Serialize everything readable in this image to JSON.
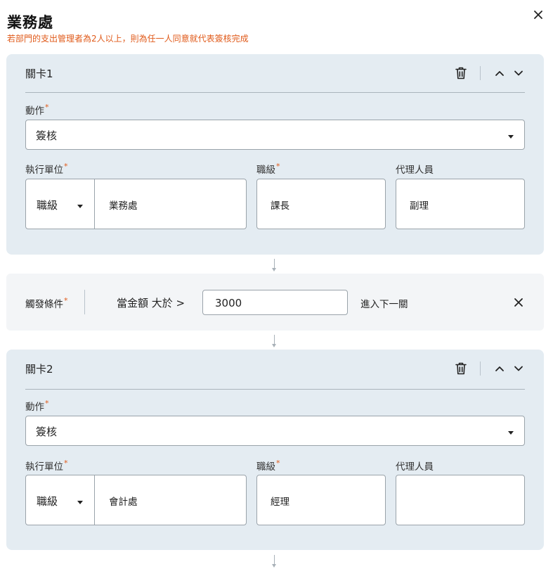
{
  "dialog": {
    "title": "業務處",
    "note": "若部門的支出管理者為2人以上，則為任一人同意就代表簽核完成"
  },
  "labels": {
    "action": "動作",
    "unit": "執行單位",
    "rank": "職級",
    "agent": "代理人員",
    "required_mark": "*"
  },
  "stages": [
    {
      "title": "關卡1",
      "action_value": "簽核",
      "unit_type": "職級",
      "unit_name": "業務處",
      "rank_value": "課長",
      "agent_value": "副理"
    },
    {
      "title": "關卡2",
      "action_value": "簽核",
      "unit_type": "職級",
      "unit_name": "會計處",
      "rank_value": "經理",
      "agent_value": ""
    }
  ],
  "condition": {
    "label": "觸發條件",
    "text": "當金額 大於 >",
    "amount": "3000",
    "next_text": "進入下一關"
  },
  "icons": {
    "close": "close-icon",
    "trash": "trash-icon",
    "up": "chevron-up-icon",
    "down": "chevron-down-icon"
  },
  "colors": {
    "required": "#e05a1a",
    "stage_background": "#e4ecf2",
    "condition_background": "#f3f5f7"
  }
}
